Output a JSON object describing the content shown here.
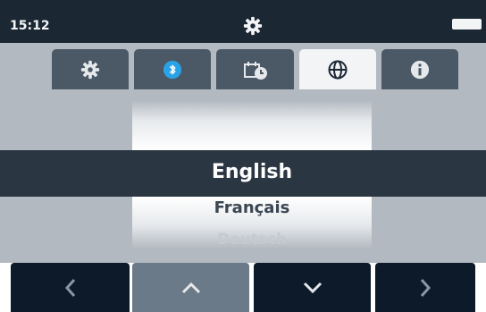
{
  "status_bar": {
    "time": "15:12",
    "title_icon": "gear-icon",
    "battery_icon": "battery-icon"
  },
  "tabs": [
    {
      "icon": "gear-icon",
      "active": false
    },
    {
      "icon": "bluetooth-icon",
      "active": false
    },
    {
      "icon": "date-time-icon",
      "active": false
    },
    {
      "icon": "globe-icon",
      "active": true
    },
    {
      "icon": "info-icon",
      "active": false
    }
  ],
  "language_picker": {
    "selected": "English",
    "next": "Français",
    "faded": "Deutsch"
  },
  "nav_buttons": [
    {
      "icon": "chevron-left-icon"
    },
    {
      "icon": "chevron-up-icon"
    },
    {
      "icon": "chevron-down-icon"
    },
    {
      "icon": "chevron-right-icon"
    }
  ],
  "colors": {
    "status_bar": "#1c2734",
    "panel": "#b2b9c0",
    "tab_inactive": "#4b5865",
    "tab_active": "#f2f4f6",
    "selection_band": "#2b3643",
    "bluetooth_accent": "#2aa3e6",
    "button_dark": "#0d1a2a",
    "button_light": "#6b7a88"
  }
}
